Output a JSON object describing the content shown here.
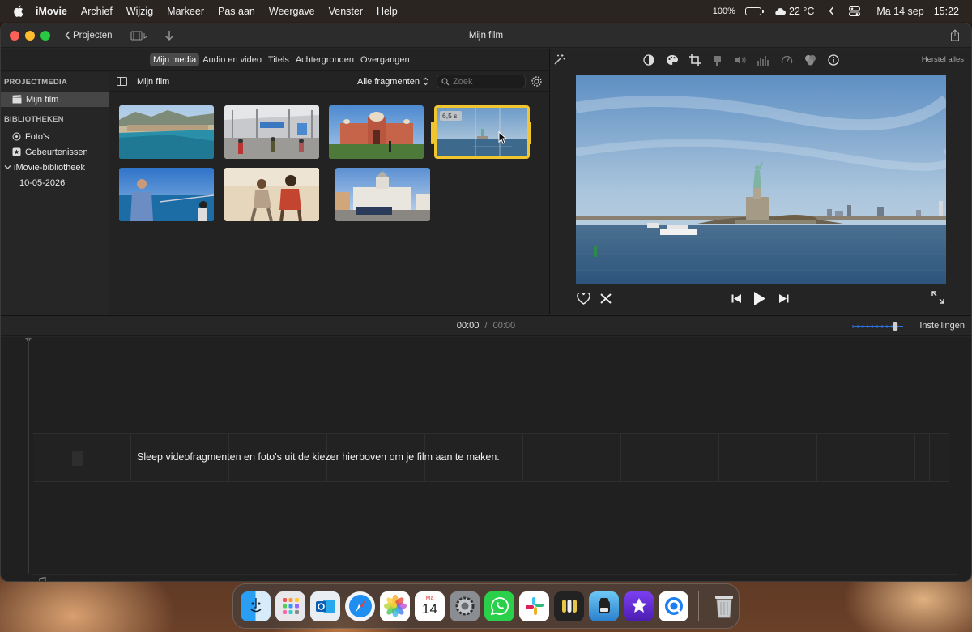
{
  "menubar": {
    "app_name": "iMovie",
    "items": [
      "Archief",
      "Wijzig",
      "Markeer",
      "Pas aan",
      "Weergave",
      "Venster",
      "Help"
    ],
    "battery_percent": "100%",
    "battery_level": 1.0,
    "weather": "22 °C",
    "date": "Ma 14 sep",
    "time": "15:22"
  },
  "window": {
    "title": "Mijn film",
    "projects_label": "Projecten"
  },
  "media_tabs": [
    "Mijn media",
    "Audio en video",
    "Titels",
    "Achtergronden",
    "Overgangen"
  ],
  "media_tabs_active": 0,
  "sidebar": {
    "section_project": "PROJECTMEDIA",
    "project_item": "Mijn film",
    "section_libraries": "BIBLIOTHEKEN",
    "photos": "Foto's",
    "events": "Gebeurtenissen",
    "library": "iMovie-bibliotheek",
    "library_date": "10-05-2026"
  },
  "browser": {
    "title": "Mijn film",
    "filter": "Alle fragmenten",
    "search_placeholder": "Zoek",
    "selected_clip_duration": "6,5 s."
  },
  "clips": [
    {
      "subject": "coastal-town-clip"
    },
    {
      "subject": "airport-terminal-clip"
    },
    {
      "subject": "red-fort-palace-clip"
    },
    {
      "subject": "statue-of-liberty-clip",
      "selected": true
    },
    {
      "subject": "fisherman-pier-clip"
    },
    {
      "subject": "couple-beach-clip"
    },
    {
      "subject": "white-palace-square-clip"
    }
  ],
  "viewer": {
    "reset_label": "Herstel alles"
  },
  "timeline": {
    "current_time": "00:00",
    "separator": "/",
    "total_time": "00:00",
    "settings_label": "Instellingen",
    "zoom_level": 0.9,
    "drop_hint": "Sleep videofragmenten en foto's uit de kiezer hierboven om je film aan te maken."
  },
  "dock": {
    "apps": [
      "finder-icon",
      "launchpad-icon",
      "outlook-icon",
      "safari-icon",
      "photos-icon",
      "calendar-icon",
      "system-settings-icon",
      "whatsapp-icon",
      "slack-icon",
      "keychain-icon",
      "istat-icon",
      "imovie-icon",
      "quicktime-icon",
      "trash-icon"
    ],
    "calendar_month": "Ma",
    "calendar_day": "14"
  },
  "colors": {
    "selection": "#f0c530",
    "accent": "#2d6fd8"
  }
}
